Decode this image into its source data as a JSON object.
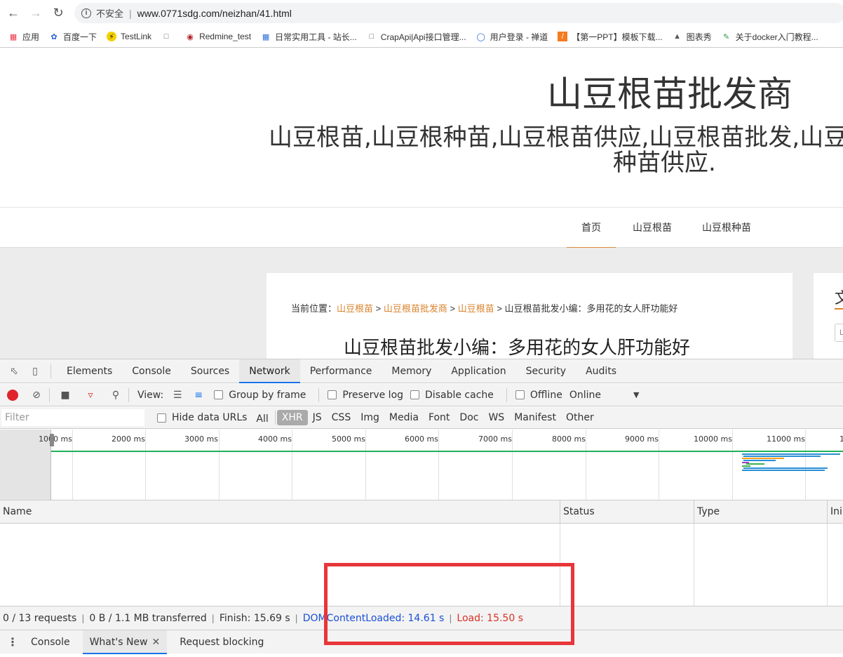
{
  "browser": {
    "security_label": "不安全",
    "url": "www.0771sdg.com/neizhan/41.html",
    "bookmarks": [
      "应用",
      "百度一下",
      "TestLink",
      "",
      "Redmine_test",
      "日常实用工具 - 站长...",
      "CrapApi|Api接口管理...",
      "用户登录 - 禅道",
      "【第一PPT】模板下载...",
      "图表秀",
      "关于docker入门教程..."
    ]
  },
  "site": {
    "title": "山豆根苗批发商",
    "subtitle_line1": "山豆根苗,山豆根种苗,山豆根苗供应,山豆根苗批发,山豆",
    "subtitle_line2": "种苗供应.",
    "nav": [
      "首页",
      "山豆根苗",
      "山豆根种苗"
    ],
    "breadcrumb": {
      "prefix": "当前位置：",
      "links": [
        "山豆根苗",
        "山豆根苗批发商",
        "山豆根苗"
      ],
      "sep": " > ",
      "current": "山豆根苗批发小编：多用花的女人肝功能好"
    },
    "article_title": "山豆根苗批发小编：多用花的女人肝功能好",
    "side_title": "文",
    "side_input": "L"
  },
  "devtools": {
    "tabs": [
      "Elements",
      "Console",
      "Sources",
      "Network",
      "Performance",
      "Memory",
      "Application",
      "Security",
      "Audits"
    ],
    "active_tab": "Network",
    "toolbar": {
      "view_label": "View:",
      "group_by_frame": "Group by frame",
      "preserve_log": "Preserve log",
      "disable_cache": "Disable cache",
      "offline": "Offline",
      "throttle": "Online"
    },
    "filter": {
      "placeholder": "Filter",
      "hide_data_urls": "Hide data URLs",
      "types": [
        "All",
        "XHR",
        "JS",
        "CSS",
        "Img",
        "Media",
        "Font",
        "Doc",
        "WS",
        "Manifest",
        "Other"
      ],
      "active_type": "XHR"
    },
    "overview_ticks": [
      "1000 ms",
      "2000 ms",
      "3000 ms",
      "4000 ms",
      "5000 ms",
      "6000 ms",
      "7000 ms",
      "8000 ms",
      "9000 ms",
      "10000 ms",
      "11000 ms",
      "1"
    ],
    "columns": [
      "Name",
      "Status",
      "Type",
      "Ini"
    ],
    "status_bar": {
      "requests": "0 / 13 requests",
      "transferred": "0 B / 1.1 MB transferred",
      "finish": "Finish: 15.69 s",
      "dom_content_loaded": "DOMContentLoaded: 14.61 s",
      "load": "Load: 15.50 s"
    },
    "drawer_tabs": [
      "Console",
      "What's New",
      "Request blocking"
    ],
    "drawer_active": "What's New"
  },
  "colors": {
    "accent_orange": "#d9822b",
    "devtools_blue": "#1a73e8",
    "annotation_red": "#e8363a",
    "record_red": "#e0242c"
  }
}
